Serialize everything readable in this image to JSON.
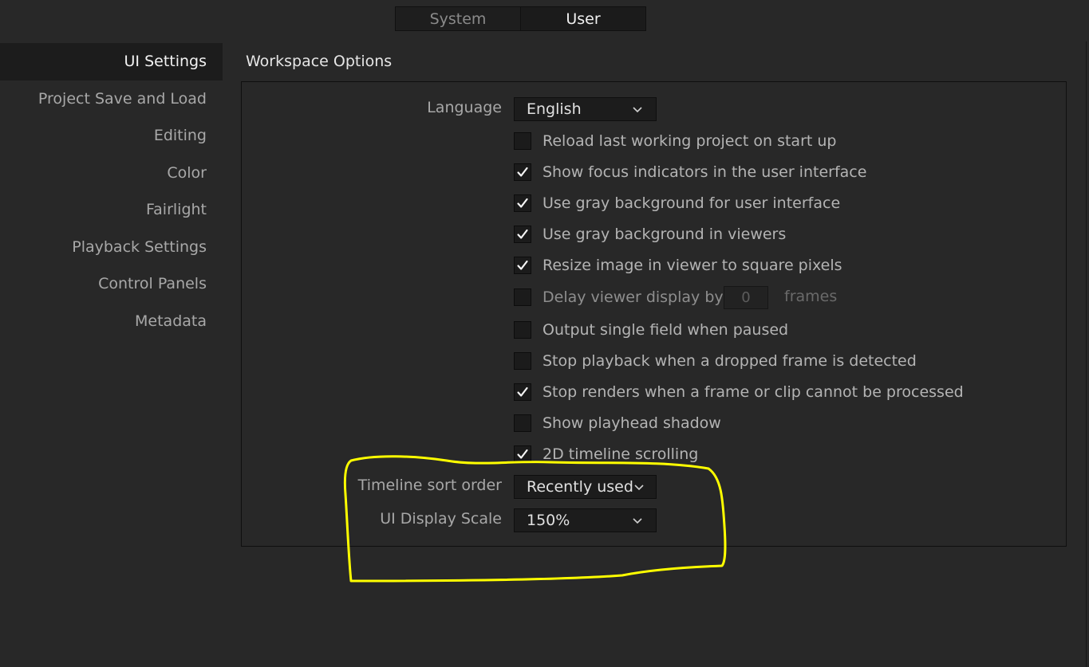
{
  "top_tabs": [
    {
      "label": "System",
      "active": false
    },
    {
      "label": "User",
      "active": true
    }
  ],
  "sidebar": {
    "items": [
      {
        "label": "UI Settings",
        "active": true
      },
      {
        "label": "Project Save and Load"
      },
      {
        "label": "Editing"
      },
      {
        "label": "Color"
      },
      {
        "label": "Fairlight"
      },
      {
        "label": "Playback Settings"
      },
      {
        "label": "Control Panels"
      },
      {
        "label": "Metadata"
      }
    ]
  },
  "workspace": {
    "title": "Workspace Options",
    "language_label": "Language",
    "language_value": "English",
    "options": [
      {
        "label": "Reload last working project on start up",
        "checked": false
      },
      {
        "label": "Show focus indicators in the user interface",
        "checked": true
      },
      {
        "label": "Use gray background for user interface",
        "checked": true
      },
      {
        "label": "Use gray background in viewers",
        "checked": true
      },
      {
        "label": "Resize image in viewer to square pixels",
        "checked": true
      },
      {
        "label": "Delay viewer display by",
        "checked": false
      },
      {
        "label": "Output single field when paused",
        "checked": false
      },
      {
        "label": "Stop playback when a dropped frame is detected",
        "checked": false
      },
      {
        "label": "Stop renders when a frame or clip cannot be processed",
        "checked": true
      },
      {
        "label": "Show playhead shadow",
        "checked": false
      },
      {
        "label": "2D timeline scrolling",
        "checked": true
      }
    ],
    "delay_value": "0",
    "delay_unit": "frames",
    "timeline_sort_label": "Timeline sort order",
    "timeline_sort_value": "Recently used",
    "ui_scale_label": "UI Display Scale",
    "ui_scale_value": "150%"
  },
  "colors": {
    "background": "#282828",
    "annotation": "#ffff00"
  }
}
